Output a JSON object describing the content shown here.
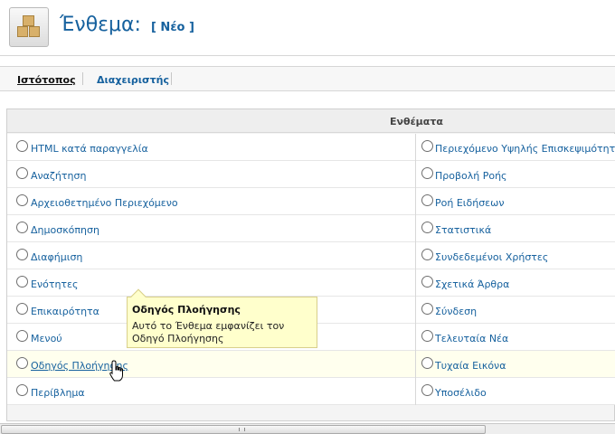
{
  "header": {
    "title": "Ένθεμα:",
    "subtitle": "[ Νέο ]",
    "icon": "module-manager-icon"
  },
  "tabs": [
    {
      "label": "Ιστότοπος",
      "active": true
    },
    {
      "label": "Διαχειριστής",
      "active": false
    }
  ],
  "panel": {
    "header": "Ενθέματα",
    "left_items": [
      {
        "label": "HTML κατά παραγγελία"
      },
      {
        "label": "Αναζήτηση"
      },
      {
        "label": "Αρχειοθετημένο Περιεχόμενο"
      },
      {
        "label": "Δημοσκόπηση"
      },
      {
        "label": "Διαφήμιση"
      },
      {
        "label": "Ενότητες"
      },
      {
        "label": "Επικαιρότητα"
      },
      {
        "label": "Μενού"
      },
      {
        "label": "Οδηγός Πλοήγησης"
      },
      {
        "label": "Περίβλημα"
      }
    ],
    "right_items": [
      {
        "label": "Περιεχόμενο Υψηλής Επισκεψιμότητας"
      },
      {
        "label": "Προβολή Ροής"
      },
      {
        "label": "Ροή Ειδήσεων"
      },
      {
        "label": "Στατιστικά"
      },
      {
        "label": "Συνδεδεμένοι Χρήστες"
      },
      {
        "label": "Σχετικά Άρθρα"
      },
      {
        "label": "Σύνδεση"
      },
      {
        "label": "Τελευταία Νέα"
      },
      {
        "label": "Τυχαία Εικόνα"
      },
      {
        "label": "Υποσέλιδο"
      }
    ]
  },
  "tooltip": {
    "title": "Οδηγός Πλοήγησης",
    "body": "Αυτό το Ένθεμα εμφανίζει τον Οδηγό Πλοήγησης"
  },
  "colors": {
    "link": "#16619e",
    "highlight_row": "#ffffee",
    "tooltip_bg": "#ffffcc"
  }
}
